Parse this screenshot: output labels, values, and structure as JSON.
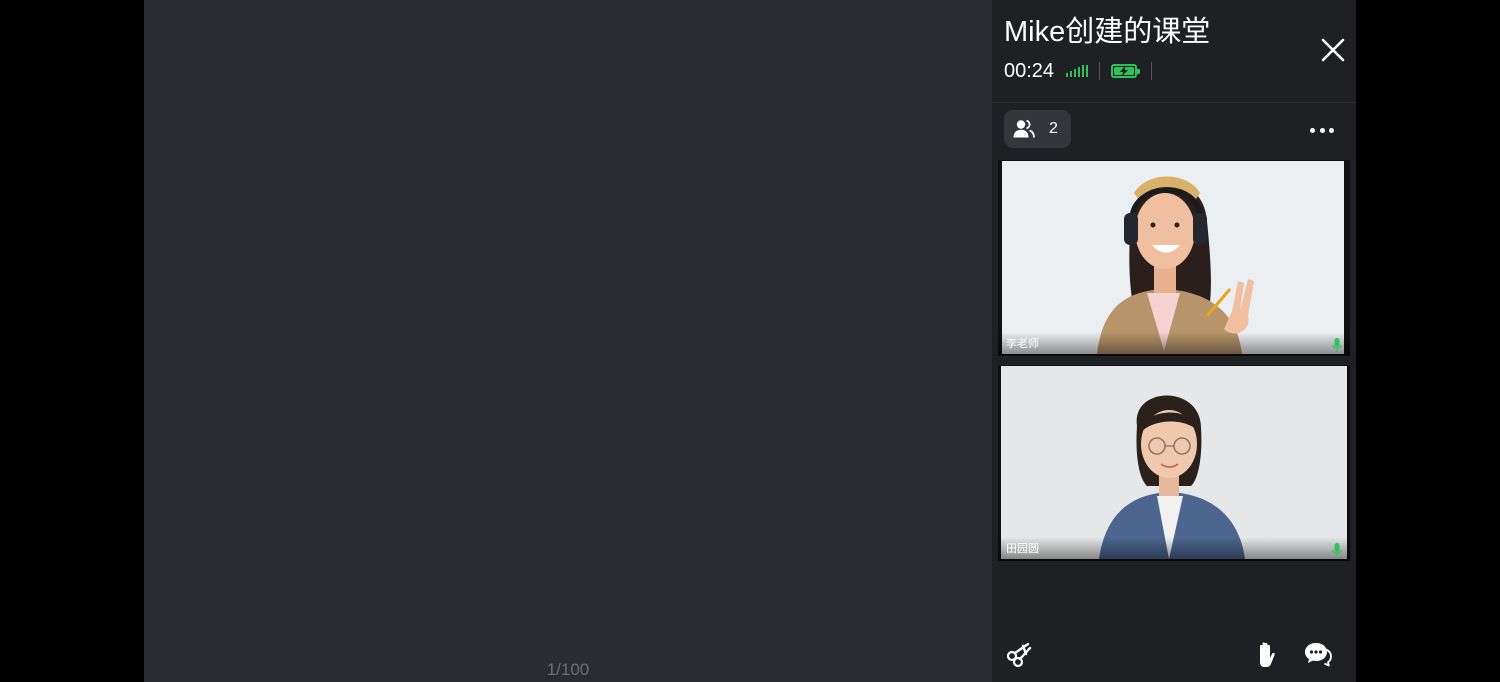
{
  "whiteboard": {
    "page_indicator": "1/100"
  },
  "panel": {
    "title": "Mike创建的课堂",
    "timer": "00:24",
    "participants_count": "2",
    "videos": [
      {
        "name": "李老师",
        "mic": "on"
      },
      {
        "name": "田园圆",
        "mic": "on"
      }
    ]
  },
  "icons": {
    "signal": "signal-strength-icon",
    "battery": "battery-charging-icon",
    "close": "close-icon",
    "participants": "users-icon",
    "more": "more-horizontal-icon",
    "mic": "microphone-icon",
    "scissors": "scissors-icon",
    "hand": "raise-hand-icon",
    "chat": "chat-bubbles-icon"
  },
  "colors": {
    "accent_green": "#2ec25a",
    "panel_bg": "#1f2023",
    "whiteboard_bg": "#2b2c31"
  }
}
